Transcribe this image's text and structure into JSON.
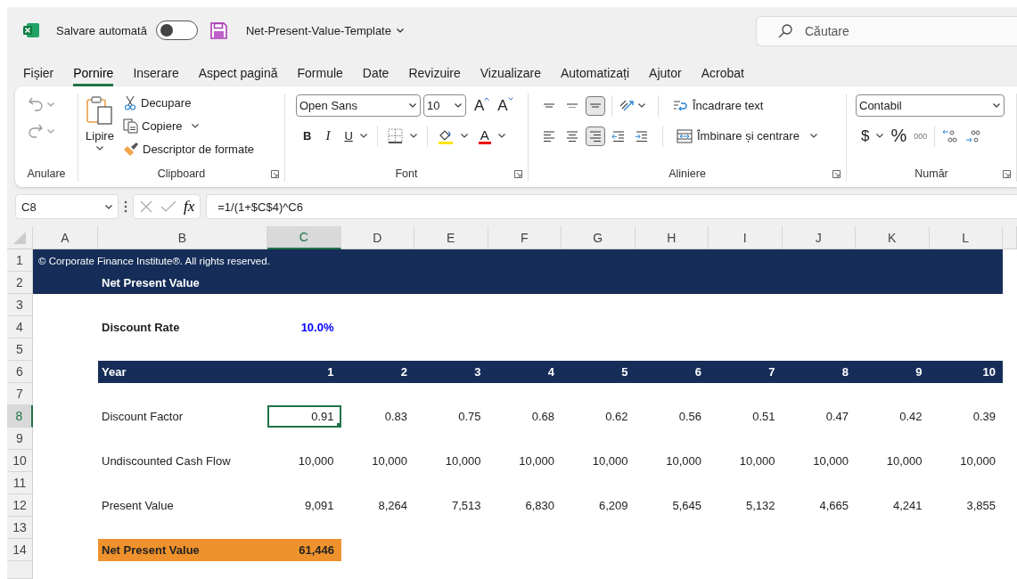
{
  "title_bar": {
    "autosave_label": "Salvare automată",
    "autosave_on": false,
    "file_name": "Net-Present-Value-Template",
    "search_placeholder": "Căutare"
  },
  "menu_tabs": [
    {
      "label": "Fișier",
      "selected": false
    },
    {
      "label": "Pornire",
      "selected": true
    },
    {
      "label": "Inserare",
      "selected": false
    },
    {
      "label": "Aspect pagină",
      "selected": false
    },
    {
      "label": "Formule",
      "selected": false
    },
    {
      "label": "Date",
      "selected": false
    },
    {
      "label": "Revizuire",
      "selected": false
    },
    {
      "label": "Vizualizare",
      "selected": false
    },
    {
      "label": "Automatizați",
      "selected": false
    },
    {
      "label": "Ajutor",
      "selected": false
    },
    {
      "label": "Acrobat",
      "selected": false
    }
  ],
  "ribbon": {
    "undo_group": {
      "label": "Anulare"
    },
    "clipboard": {
      "label": "Clipboard",
      "paste": "Lipire",
      "cut": "Decupare",
      "copy": "Copiere",
      "format_painter": "Descriptor de formate"
    },
    "font": {
      "label": "Font",
      "font_name": "Open Sans",
      "font_size": "10",
      "grow": "A",
      "shrink": "A",
      "bold": "B",
      "italic": "I",
      "underline": "U",
      "font_color": "A"
    },
    "alignment": {
      "label": "Aliniere",
      "wrap_text": "Încadrare text",
      "merge": "Îmbinare și centrare",
      "buttons": [
        {
          "kind": "top",
          "selected": false
        },
        {
          "kind": "middle",
          "selected": false
        },
        {
          "kind": "bottom",
          "selected": true
        },
        {
          "kind": "left",
          "selected": false
        },
        {
          "kind": "center",
          "selected": false
        },
        {
          "kind": "right",
          "selected": true
        }
      ]
    },
    "number": {
      "label": "Număr",
      "format": "Contabil",
      "currency": "$",
      "percent": "%",
      "thousands": "000"
    }
  },
  "formula_bar": {
    "name_box": "C8",
    "fx": "fx",
    "formula": "=1/(1+$C$4)^C6"
  },
  "sheet": {
    "columns": [
      {
        "label": "A",
        "selected": false
      },
      {
        "label": "B",
        "selected": false
      },
      {
        "label": "C",
        "selected": true
      },
      {
        "label": "D",
        "selected": false
      },
      {
        "label": "E",
        "selected": false
      },
      {
        "label": "F",
        "selected": false
      },
      {
        "label": "G",
        "selected": false
      },
      {
        "label": "H",
        "selected": false
      },
      {
        "label": "I",
        "selected": false
      },
      {
        "label": "J",
        "selected": false
      },
      {
        "label": "K",
        "selected": false
      },
      {
        "label": "L",
        "selected": false
      }
    ],
    "rows": [
      {
        "number": "1",
        "selected": false,
        "kind": "note",
        "text": "© Corporate Finance Institute®. All rights reserved."
      },
      {
        "number": "2",
        "selected": false,
        "kind": "title",
        "text": "Net Present Value"
      },
      {
        "number": "3",
        "selected": false,
        "kind": "blank"
      },
      {
        "number": "4",
        "selected": false,
        "kind": "input",
        "label": "Discount Rate",
        "values": [
          "10.0%"
        ]
      },
      {
        "number": "5",
        "selected": false,
        "kind": "blank"
      },
      {
        "number": "6",
        "selected": false,
        "kind": "header",
        "label": "Year",
        "values": [
          "1",
          "2",
          "3",
          "4",
          "5",
          "6",
          "7",
          "8",
          "9",
          "10"
        ]
      },
      {
        "number": "7",
        "selected": false,
        "kind": "blank"
      },
      {
        "number": "8",
        "selected": true,
        "kind": "data",
        "label": "Discount Factor",
        "values": [
          "0.91",
          "0.83",
          "0.75",
          "0.68",
          "0.62",
          "0.56",
          "0.51",
          "0.47",
          "0.42",
          "0.39"
        ]
      },
      {
        "number": "9",
        "selected": false,
        "kind": "blank"
      },
      {
        "number": "10",
        "selected": false,
        "kind": "data",
        "label": "Undiscounted Cash Flow",
        "values": [
          "10,000",
          "10,000",
          "10,000",
          "10,000",
          "10,000",
          "10,000",
          "10,000",
          "10,000",
          "10,000",
          "10,000"
        ]
      },
      {
        "number": "11",
        "selected": false,
        "kind": "blank"
      },
      {
        "number": "12",
        "selected": false,
        "kind": "data",
        "label": "Present Value",
        "values": [
          "9,091",
          "8,264",
          "7,513",
          "6,830",
          "6,209",
          "5,645",
          "5,132",
          "4,665",
          "4,241",
          "3,855"
        ]
      },
      {
        "number": "13",
        "selected": false,
        "kind": "blank"
      },
      {
        "number": "14",
        "selected": false,
        "kind": "total",
        "label": "Net Present Value",
        "values": [
          "61,446"
        ]
      }
    ]
  }
}
